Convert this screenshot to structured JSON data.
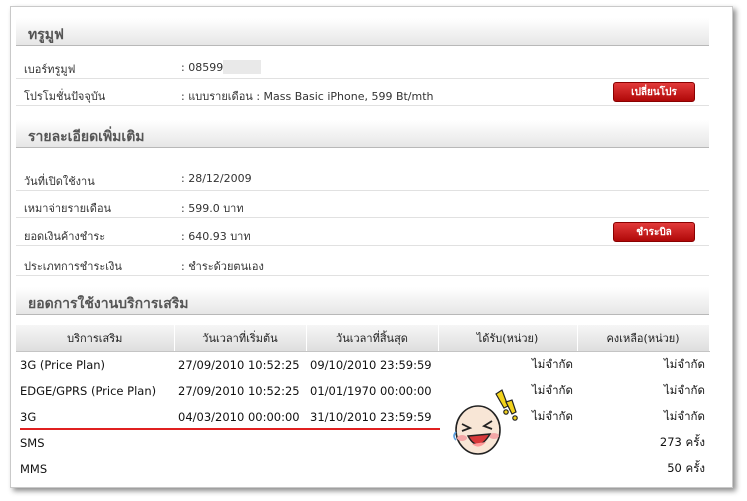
{
  "truemove": {
    "section_title": "ทรูมูฟ",
    "rows": [
      {
        "label": "เบอร์ทรูมูฟ",
        "value": ": 08599"
      },
      {
        "label": "โปรโมชั่นปัจจุบัน",
        "value": ": แบบรายเดือน : Mass Basic iPhone, 599 Bt/mth",
        "button": "เปลี่ยนโปร"
      }
    ]
  },
  "details": {
    "section_title": "รายละเอียดเพิ่มเติม",
    "rows": [
      {
        "label": "วันที่เปิดใช้งาน",
        "value": ": 28/12/2009"
      },
      {
        "label": "เหมาจ่ายรายเดือน",
        "value": ": 599.0 บาท"
      },
      {
        "label": "ยอดเงินค้างชำระ",
        "value": ": 640.93 บาท",
        "button": "ชำระบิล"
      },
      {
        "label": "ประเภทการชำระเงิน",
        "value": ": ชำระด้วยตนเอง"
      }
    ]
  },
  "services": {
    "section_title": "ยอดการใช้งานบริการเสริม",
    "headers": [
      "บริการเสริม",
      "วันเวลาที่เริ่มต้น",
      "วันเวลาที่สิ้นสุด",
      "ได้รับ(หน่วย)",
      "คงเหลือ(หน่วย)"
    ],
    "rows": [
      [
        "3G (Price Plan)",
        "27/09/2010 10:52:25",
        "09/10/2010 23:59:59",
        "ไม่จำกัด",
        "ไม่จำกัด"
      ],
      [
        "EDGE/GPRS (Price Plan)",
        "27/09/2010 10:52:25",
        "01/01/1970 00:00:00",
        "ไม่จำกัด",
        "ไม่จำกัด"
      ],
      [
        "3G",
        "04/03/2010 00:00:00",
        "31/10/2010 23:59:59",
        "ไม่จำกัด",
        "ไม่จำกัด"
      ],
      [
        "SMS",
        "",
        "",
        "",
        "273 ครั้ง"
      ],
      [
        "MMS",
        "",
        "",
        "",
        "50 ครั้ง"
      ]
    ]
  },
  "decor": {
    "emoticon_icon": "laughing-face-icon",
    "underline_color": "#e02020",
    "button_color": "#c41414"
  }
}
